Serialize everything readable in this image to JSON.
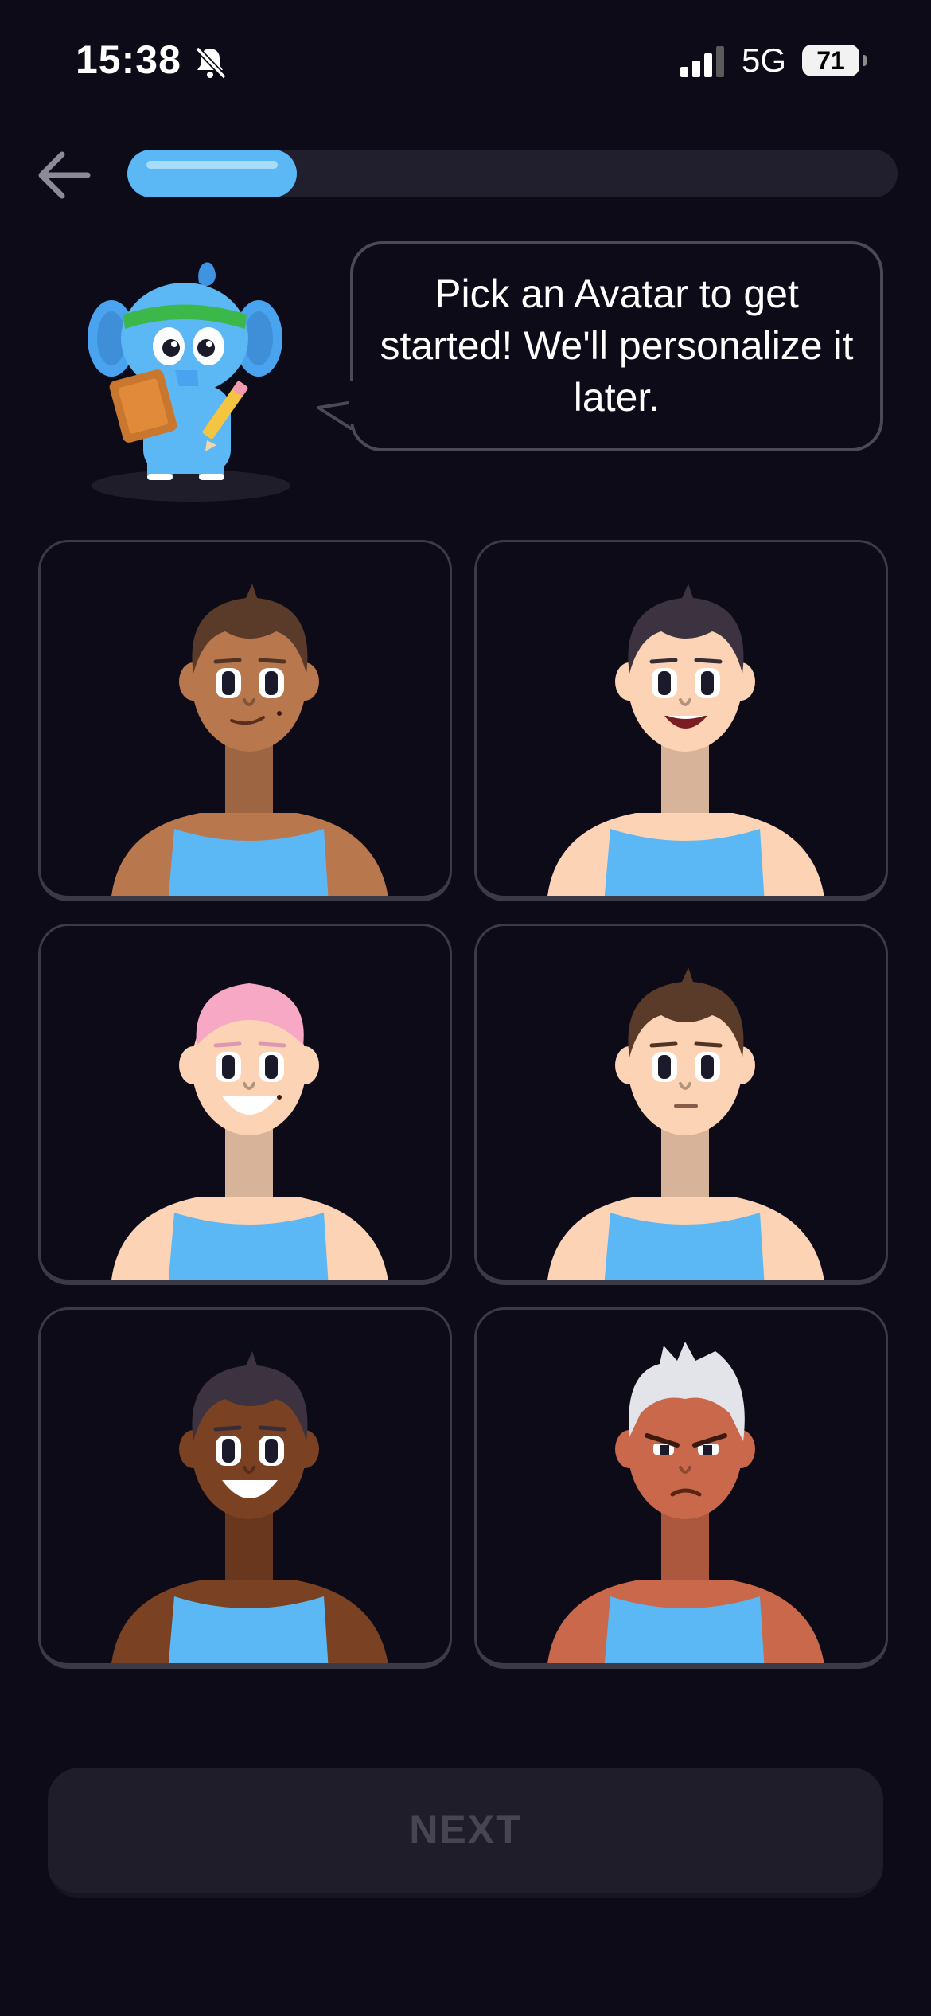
{
  "status_bar": {
    "time": "15:38",
    "network": "5G",
    "battery": "71"
  },
  "progress": {
    "fraction": 0.22
  },
  "prompt": {
    "text": "Pick an Avatar to get started! We'll personalize it later."
  },
  "avatars": [
    {
      "name": "avatar-1",
      "skin": "#b9774e",
      "hair": "#5a3a28",
      "expression": "smirk",
      "mole": true
    },
    {
      "name": "avatar-2",
      "skin": "#fcd3b4",
      "hair": "#3d3340",
      "expression": "open-smile",
      "mole": false
    },
    {
      "name": "avatar-3",
      "skin": "#fcd3b4",
      "hair": "#f7a8c4",
      "expression": "big-smile",
      "mole": true
    },
    {
      "name": "avatar-4",
      "skin": "#fcd3b4",
      "hair": "#5a3a28",
      "expression": "neutral",
      "mole": false
    },
    {
      "name": "avatar-5",
      "skin": "#7a4122",
      "hair": "#3d3340",
      "expression": "big-smile",
      "mole": false
    },
    {
      "name": "avatar-6",
      "skin": "#c9684a",
      "hair": "#e3e3ea",
      "expression": "angry",
      "mole": false
    }
  ],
  "tank_color": "#5bb8f5",
  "next_button": {
    "label": "NEXT",
    "enabled": false
  }
}
